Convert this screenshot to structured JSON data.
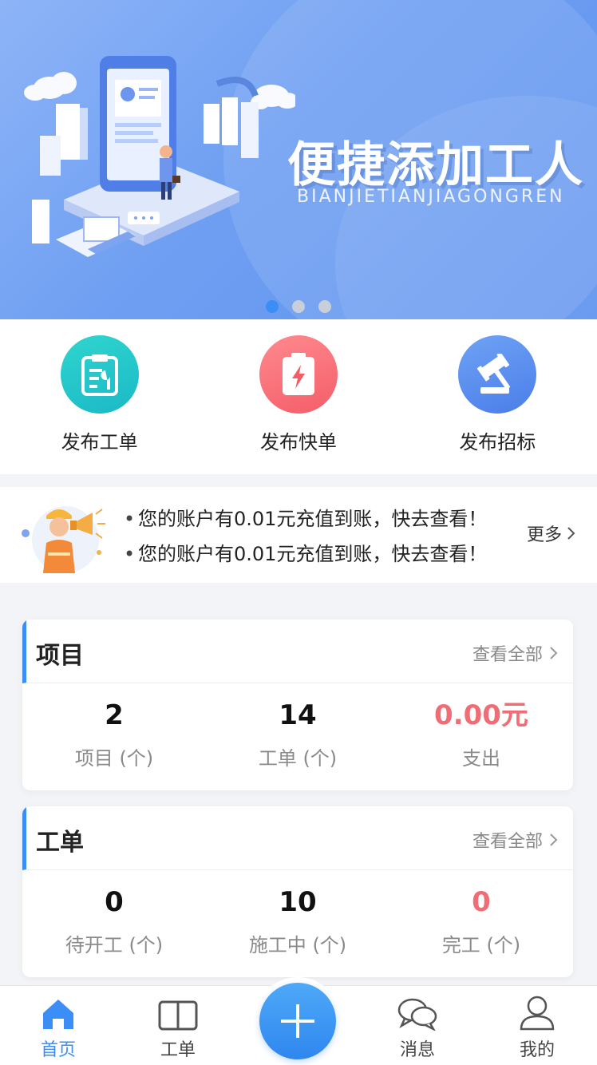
{
  "banner": {
    "title": "便捷添加工人",
    "subtitle": "BIANJIETIANJIAGONGREN",
    "slides": 3,
    "active_slide": 1
  },
  "actions": [
    {
      "label": "发布工单",
      "icon": "clipboard-wrench-icon",
      "color": "#1fc4c9"
    },
    {
      "label": "发布快单",
      "icon": "lightning-clipboard-icon",
      "color": "#f45d68"
    },
    {
      "label": "发布招标",
      "icon": "gavel-icon",
      "color": "#4a7ee8"
    }
  ],
  "notice": {
    "items": [
      "您的账户有0.01元充值到账，快去查看！",
      "您的账户有0.01元充值到账，快去查看！"
    ],
    "more_label": "更多"
  },
  "project_card": {
    "title": "项目",
    "link_label": "查看全部",
    "stats": [
      {
        "value": "2",
        "label": "项目 (个)"
      },
      {
        "value": "14",
        "label": "工单 (个)"
      },
      {
        "value": "0.00元",
        "label": "支出"
      }
    ]
  },
  "order_card": {
    "title": "工单",
    "link_label": "查看全部",
    "stats": [
      {
        "value": "0",
        "label": "待开工 (个)"
      },
      {
        "value": "10",
        "label": "施工中 (个)"
      },
      {
        "value": "0",
        "label": "完工 (个)"
      }
    ]
  },
  "tabbar": {
    "home": "首页",
    "orders": "工单",
    "messages": "消息",
    "me": "我的",
    "active": "home"
  },
  "colors": {
    "accent": "#3a8ef5",
    "highlight_red": "#ef6d75"
  }
}
